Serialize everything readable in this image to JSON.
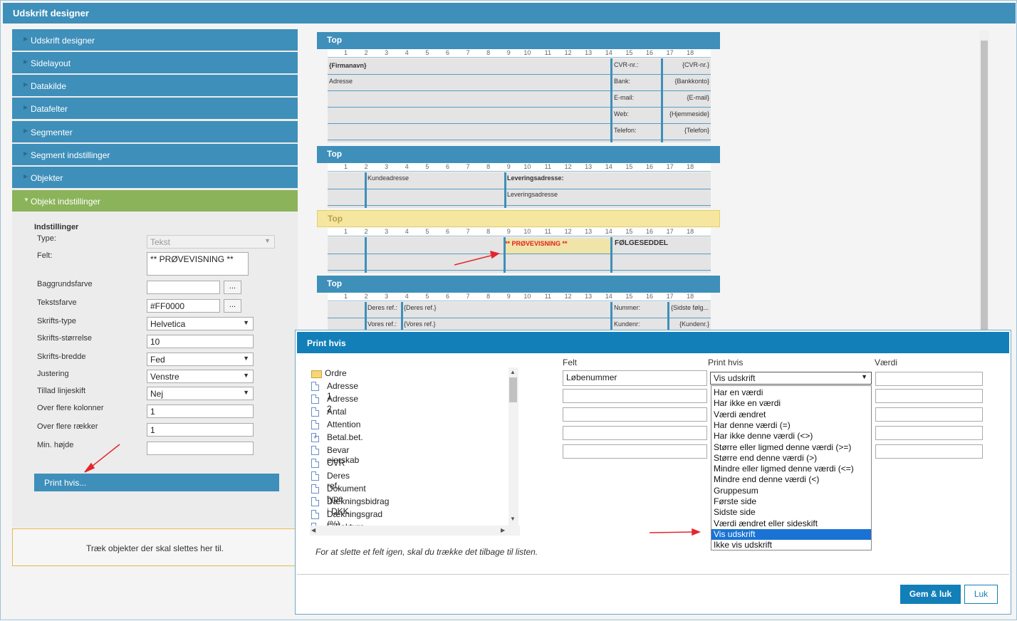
{
  "app": {
    "title": "Udskrift designer"
  },
  "accordion": [
    {
      "label": "Udskrift designer",
      "active": false
    },
    {
      "label": "Sidelayout",
      "active": false
    },
    {
      "label": "Datakilde",
      "active": false
    },
    {
      "label": "Datafelter",
      "active": false
    },
    {
      "label": "Segmenter",
      "active": false
    },
    {
      "label": "Segment indstillinger",
      "active": false
    },
    {
      "label": "Objekter",
      "active": false
    },
    {
      "label": "Objekt indstillinger",
      "active": true
    }
  ],
  "settings": {
    "heading": "Indstillinger",
    "type_label": "Type:",
    "type_value": "Tekst",
    "felt_label": "Felt:",
    "felt_value": "** PRØVEVISNING **",
    "bg_label": "Baggrundsfarve",
    "bg_value": "",
    "textcolor_label": "Tekstsfarve",
    "textcolor_value": "#FF0000",
    "fonttype_label": "Skrifts-type",
    "fonttype_value": "Helvetica",
    "fontsize_label": "Skrifts-størrelse",
    "fontsize_value": "10",
    "fontweight_label": "Skrifts-bredde",
    "fontweight_value": "Fed",
    "align_label": "Justering",
    "align_value": "Venstre",
    "wrap_label": "Tillad linjeskift",
    "wrap_value": "Nej",
    "cols_label": "Over flere kolonner",
    "cols_value": "1",
    "rows_label": "Over flere rækker",
    "rows_value": "1",
    "minh_label": "Min. højde",
    "minh_value": "",
    "dots": "...",
    "print_if_button": "Print hvis..."
  },
  "trash_text": "Træk objekter der skal slettes her til.",
  "designer": {
    "ruler": [
      "1",
      "2",
      "3",
      "4",
      "5",
      "6",
      "7",
      "8",
      "9",
      "10",
      "11",
      "12",
      "13",
      "14",
      "15",
      "16",
      "17",
      "18"
    ],
    "segments": [
      {
        "title": "Top",
        "cells": [
          "{Firmanavn}",
          "Adresse",
          "CVR-nr.:",
          "{CVR-nr.}",
          "Bank:",
          "{Bankkonto}",
          "E-mail:",
          "{E-mail}",
          "Web:",
          "{Hjemmeside}",
          "Telefon:",
          "{Telefon}"
        ]
      },
      {
        "title": "Top",
        "cells": [
          "Kundeadresse",
          "Leveringsadresse:",
          "Leveringsadresse"
        ]
      },
      {
        "title": "Top",
        "cells": [
          "** PRØVEVISNING **",
          "FØLGESEDDEL"
        ]
      },
      {
        "title": "Top",
        "cells": [
          "Deres ref.:",
          "{Deres ref.}",
          "Nummer:",
          "{Sidste følg...",
          "Vores ref.:",
          "{Vores ref.}",
          "Kundenr:",
          "{Kundenr.}"
        ]
      }
    ]
  },
  "dialog": {
    "title": "Print hvis",
    "tree_root": "Ordre",
    "tree_items": [
      "Adresse 1",
      "Adresse 2",
      "Antal",
      "Attention",
      "Betal.bet.",
      "Bevar ejerskab",
      "CVR",
      "Deres ref.",
      "Dokument type",
      "Dækningsbidrag i DKK",
      "Dækningsgrad (%)",
      "E-Faktura Kontaktnlys"
    ],
    "hint": "For at slette et felt igen, skal du trække det tilbage til listen.",
    "col_felt": "Felt",
    "col_print": "Print hvis",
    "col_vaerdi": "Værdi",
    "felt_first": "Løbenummer",
    "print_selected": "Vis udskrift",
    "options": [
      "Har en værdi",
      "Har ikke en værdi",
      "Værdi ændret",
      "Har denne værdi (=)",
      "Har ikke denne værdi (<>)",
      "Større eller ligmed denne værdi (>=)",
      "Større end denne værdi (>)",
      "Mindre eller ligmed denne værdi (<=)",
      "Mindre end denne værdi (<)",
      "Gruppesum",
      "Første side",
      "Sidste side",
      "Værdi ændret eller sideskift",
      "Vis udskrift",
      "Ikke vis udskrift"
    ],
    "selected_index": 13,
    "save_button": "Gem & luk",
    "close_button": "Luk"
  },
  "colors": {
    "accent": "#3e8fba",
    "active": "#8bb35a",
    "dialog": "#137fb8",
    "red_text": "#FF0000",
    "arrow": "#e3262d"
  }
}
